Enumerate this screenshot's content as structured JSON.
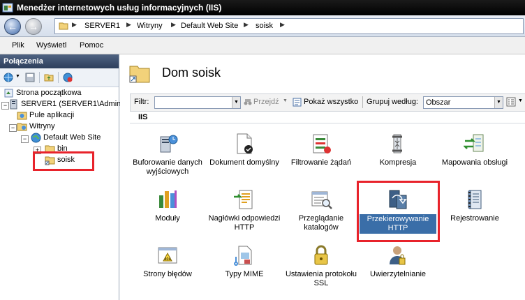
{
  "window": {
    "title": "Menedżer internetowych usług informacyjnych (IIS)"
  },
  "address": {
    "crumbs": [
      "SERVER1",
      "Witryny",
      "Default Web Site",
      "soisk"
    ]
  },
  "menu": {
    "items": [
      "Plik",
      "Wyświetl",
      "Pomoc"
    ]
  },
  "connections": {
    "header": "Połączenia",
    "tree": {
      "start_page": "Strona początkowa",
      "server": "SERVER1 (SERVER1\\Administ",
      "app_pools": "Pule aplikacji",
      "sites": "Witryny",
      "default_site": "Default Web Site",
      "bin": "bin",
      "soisk": "soisk"
    }
  },
  "main": {
    "title": "Dom soisk",
    "filter_label": "Filtr:",
    "go_label": "Przejdź",
    "show_all_label": "Pokaż wszystko",
    "group_by_label": "Grupuj według:",
    "group_by_value": "Obszar",
    "section": "IIS"
  },
  "features": [
    "Buforowanie danych wyjściowych",
    "Dokument domyślny",
    "Filtrowanie żądań",
    "Kompresja",
    "Mapowania obsługi",
    "Moduły",
    "Nagłówki odpowiedzi HTTP",
    "Przeglądanie katalogów",
    "Przekierowywanie HTTP",
    "Rejestrowanie",
    "Strony błędów",
    "Typy MIME",
    "Ustawienia protokołu SSL",
    "Uwierzytelnianie"
  ],
  "selected_feature": "Przekierowywanie HTTP",
  "colors": {
    "highlight": "#e8232b",
    "selection": "#3a6ea8"
  }
}
